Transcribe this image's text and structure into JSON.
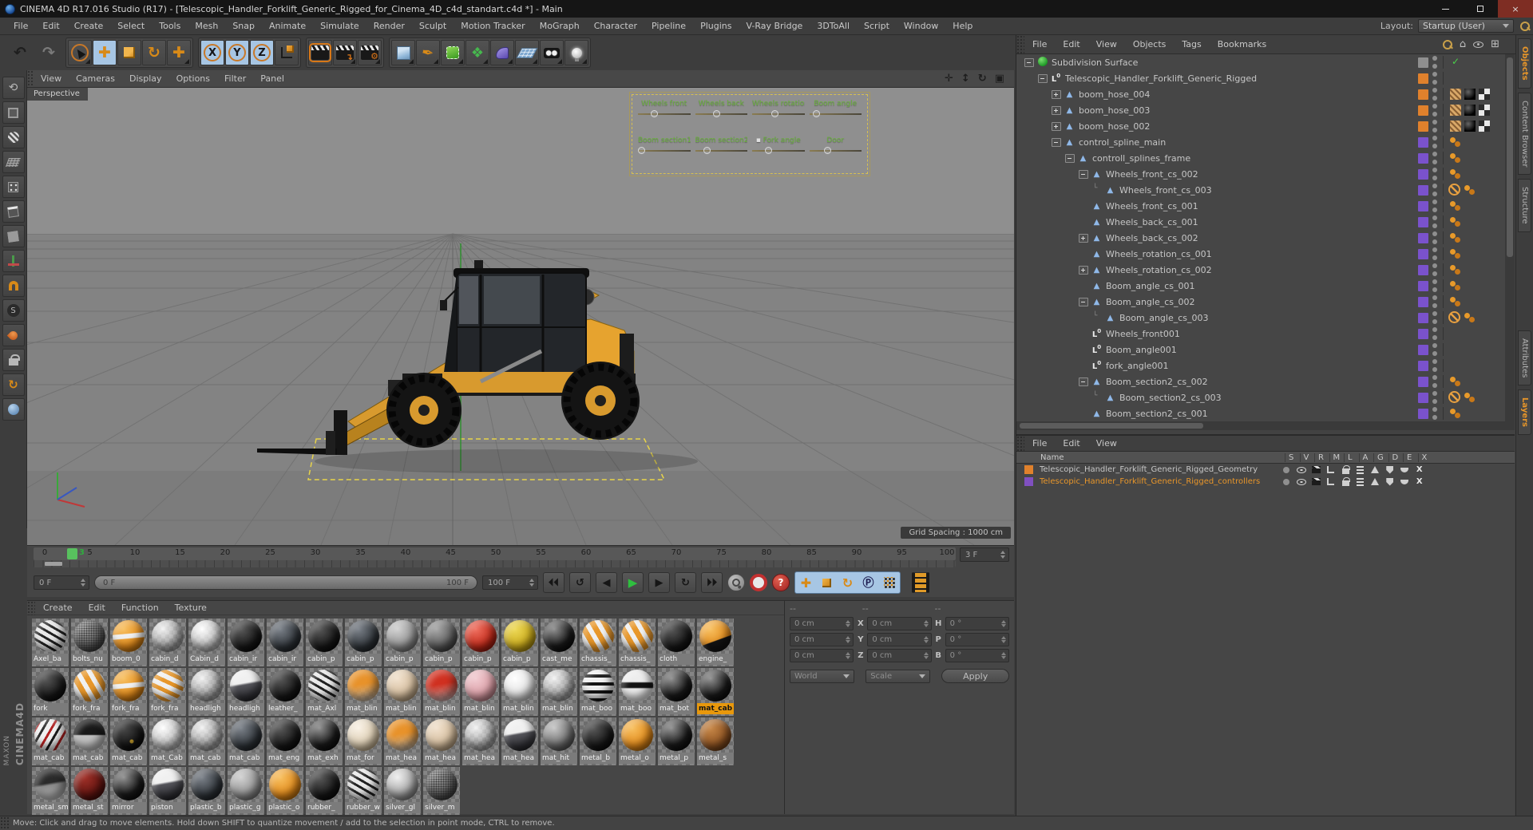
{
  "window": {
    "title": "CINEMA 4D R17.016 Studio (R17) - [Telescopic_Handler_Forklift_Generic_Rigged_for_Cinema_4D_c4d_standart.c4d *] - Main"
  },
  "menu": [
    "File",
    "Edit",
    "Create",
    "Select",
    "Tools",
    "Mesh",
    "Snap",
    "Animate",
    "Simulate",
    "Render",
    "Sculpt",
    "Motion Tracker",
    "MoGraph",
    "Character",
    "Pipeline",
    "Plugins",
    "V-Ray Bridge",
    "3DToAll",
    "Script",
    "Window",
    "Help"
  ],
  "layout_switcher": {
    "label": "Layout:",
    "value": "Startup (User)"
  },
  "toolbar_icons": [
    "undo",
    "redo",
    "live-selection",
    "move",
    "scale",
    "rotate",
    "move-active",
    "lock-x",
    "lock-y",
    "lock-z",
    "coordinate-system",
    "render-view",
    "render-to-picture-viewer",
    "edit-render-settings",
    "add-cube-object",
    "freehand-spline",
    "subdivision-surface",
    "mograph",
    "deformer",
    "floor-object",
    "camera-object",
    "light-object"
  ],
  "palette_icons": [
    "make-editable",
    "model-mode",
    "texture-mode",
    "workplane-mode",
    "points-mode",
    "edges-mode",
    "polygons-mode",
    "enable-axis",
    "snap-magnet",
    "viewport-solo",
    "paint-drop",
    "lock-workplane",
    "rotate-workplane",
    "sphere-mode"
  ],
  "viewport": {
    "menu": [
      "View",
      "Cameras",
      "Display",
      "Options",
      "Filter",
      "Panel"
    ],
    "label": "Perspective",
    "grid_spacing": "Grid Spacing : 1000 cm",
    "hud": {
      "row1": [
        {
          "label": "Wheels front",
          "pos": 0.3
        },
        {
          "label": "Wheels back",
          "pos": 0.42
        },
        {
          "label": "Wheels rotation",
          "pos": 0.45
        },
        {
          "label": "Boom angle",
          "pos": 0.08
        }
      ],
      "row2": [
        {
          "label": "Boom section1",
          "pos": 0.0
        },
        {
          "label": "Boom section2",
          "pos": 0.2
        },
        {
          "label": "Fork angle",
          "pos": 0.3,
          "mark": "mark"
        },
        {
          "label": "Door",
          "pos": 0.36
        }
      ]
    }
  },
  "timeline": {
    "ticks": [
      {
        "label": "0",
        "f": 0
      },
      {
        "label": "5",
        "f": 5
      },
      {
        "label": "10",
        "f": 10
      },
      {
        "label": "15",
        "f": 15
      },
      {
        "label": "20",
        "f": 20
      },
      {
        "label": "25",
        "f": 25
      },
      {
        "label": "30",
        "f": 30
      },
      {
        "label": "35",
        "f": 35
      },
      {
        "label": "40",
        "f": 40
      },
      {
        "label": "45",
        "f": 45
      },
      {
        "label": "50",
        "f": 50
      },
      {
        "label": "55",
        "f": 55
      },
      {
        "label": "60",
        "f": 60
      },
      {
        "label": "65",
        "f": 65
      },
      {
        "label": "70",
        "f": 70
      },
      {
        "label": "75",
        "f": 75
      },
      {
        "label": "80",
        "f": 80
      },
      {
        "label": "85",
        "f": 85
      },
      {
        "label": "90",
        "f": 90
      },
      {
        "label": "95",
        "f": 95
      },
      {
        "label": "100",
        "f": 100
      }
    ],
    "playhead_label": "3",
    "current_frame_field": "3 F",
    "start_field": "0 F",
    "end_field": "100 F",
    "range_start": "0 F",
    "range_end": "100 F"
  },
  "materials": {
    "menu": [
      "Create",
      "Edit",
      "Function",
      "Texture"
    ],
    "items": [
      {
        "name": "Axel_ba",
        "tone": "t-pbw"
      },
      {
        "name": "bolts_nu",
        "tone": "t-speck"
      },
      {
        "name": "boom_0",
        "tone": "t-ow"
      },
      {
        "name": "cabin_d",
        "tone": "t-clear"
      },
      {
        "name": "Cabin_d",
        "tone": "t-clearw"
      },
      {
        "name": "cabin_ir",
        "tone": "t-black"
      },
      {
        "name": "cabin_ir",
        "tone": "t-dgray"
      },
      {
        "name": "cabin_p",
        "tone": "t-black"
      },
      {
        "name": "cabin_p",
        "tone": "t-dgray"
      },
      {
        "name": "cabin_p",
        "tone": "t-lgray"
      },
      {
        "name": "cabin_p",
        "tone": "t-gray"
      },
      {
        "name": "cabin_p",
        "tone": "t-red"
      },
      {
        "name": "cabin_p",
        "tone": "t-yellow"
      },
      {
        "name": "cast_me",
        "tone": "t-blacksh"
      },
      {
        "name": "chassis_",
        "tone": "t-powy"
      },
      {
        "name": "chassis_",
        "tone": "t-powy"
      },
      {
        "name": "cloth",
        "tone": "t-black"
      },
      {
        "name": "engine_",
        "tone": "t-orangeb"
      },
      {
        "name": "fork",
        "tone": "t-black"
      },
      {
        "name": "fork_fra",
        "tone": "t-powy"
      },
      {
        "name": "fork_fra",
        "tone": "t-ow"
      },
      {
        "name": "fork_fra",
        "tone": "t-pwo"
      },
      {
        "name": "headligh",
        "tone": "t-clear"
      },
      {
        "name": "headligh",
        "tone": "t-chrome"
      },
      {
        "name": "leather_",
        "tone": "t-black"
      },
      {
        "name": "mat_Axl",
        "tone": "t-pbw"
      },
      {
        "name": "mat_blin",
        "tone": "t-oclear"
      },
      {
        "name": "mat_blin",
        "tone": "t-tanc"
      },
      {
        "name": "mat_blin",
        "tone": "t-redc"
      },
      {
        "name": "mat_blin",
        "tone": "t-pink"
      },
      {
        "name": "mat_blin",
        "tone": "t-frost"
      },
      {
        "name": "mat_blin",
        "tone": "t-clear"
      },
      {
        "name": "mat_boo",
        "tone": "t-stripe"
      },
      {
        "name": "mat_boo",
        "tone": "t-stripe2"
      },
      {
        "name": "mat_bot",
        "tone": "t-blacksh"
      },
      {
        "name": "mat_cab",
        "tone": "t-blacksh",
        "sel": "sel"
      },
      {
        "name": "mat_cab",
        "tone": "t-pbw2"
      },
      {
        "name": "mat_cab",
        "tone": "t-halfbw"
      },
      {
        "name": "mat_cab",
        "tone": "t-blackg"
      },
      {
        "name": "mat_Cab",
        "tone": "t-clearw"
      },
      {
        "name": "mat_cab",
        "tone": "t-clear"
      },
      {
        "name": "mat_cab",
        "tone": "t-dgray"
      },
      {
        "name": "mat_eng",
        "tone": "t-black"
      },
      {
        "name": "mat_exh",
        "tone": "t-blacksh"
      },
      {
        "name": "mat_for",
        "tone": "t-tanw"
      },
      {
        "name": "mat_hea",
        "tone": "t-oclear"
      },
      {
        "name": "mat_hea",
        "tone": "t-tanc"
      },
      {
        "name": "mat_hea",
        "tone": "t-clear"
      },
      {
        "name": "mat_hea",
        "tone": "t-chrome"
      },
      {
        "name": "mat_hit",
        "tone": "t-metal"
      },
      {
        "name": "metal_b",
        "tone": "t-black"
      },
      {
        "name": "metal_o",
        "tone": "t-orange"
      },
      {
        "name": "metal_p",
        "tone": "t-blacksh"
      },
      {
        "name": "metal_s",
        "tone": "t-brown"
      },
      {
        "name": "metal_sm",
        "tone": "t-chromeb"
      },
      {
        "name": "metal_st",
        "tone": "t-dred"
      },
      {
        "name": "mirror",
        "tone": "t-blacksh"
      },
      {
        "name": "piston",
        "tone": "t-chrome"
      },
      {
        "name": "plastic_b",
        "tone": "t-dgray"
      },
      {
        "name": "plastic_g",
        "tone": "t-lgray"
      },
      {
        "name": "plastic_o",
        "tone": "t-orange"
      },
      {
        "name": "rubber_",
        "tone": "t-black"
      },
      {
        "name": "rubber_w",
        "tone": "t-pbw"
      },
      {
        "name": "silver_gl",
        "tone": "t-silver"
      },
      {
        "name": "silver_m",
        "tone": "t-speck"
      }
    ]
  },
  "coords": {
    "headers": [
      "--",
      "--",
      "--"
    ],
    "rows": [
      {
        "pos": "0 cm",
        "axis2": "X",
        "size": "0 cm",
        "axis3": "H",
        "rot": "0 °"
      },
      {
        "pos": "0 cm",
        "axis2": "Y",
        "size": "0 cm",
        "axis3": "P",
        "rot": "0 °"
      },
      {
        "pos": "0 cm",
        "axis2": "Z",
        "size": "0 cm",
        "axis3": "B",
        "rot": "0 °"
      }
    ],
    "space": "World",
    "mode": "Scale",
    "apply": "Apply"
  },
  "object_manager": {
    "menu": [
      "File",
      "Edit",
      "View",
      "Objects",
      "Tags",
      "Bookmarks"
    ],
    "tree": [
      {
        "name": "Subdivision Surface",
        "lvl": 0,
        "exp": "minus",
        "icon": "sds",
        "chip": "#8f8f8f",
        "tags": "check"
      },
      {
        "name": "Telescopic_Handler_Forklift_Generic_Rigged",
        "lvl": 1,
        "exp": "minus",
        "icon": "null",
        "chip": "#e0812c",
        "tags": "none"
      },
      {
        "name": "boom_hose_004",
        "lvl": 2,
        "exp": "plus",
        "icon": "joint",
        "chip": "#e0812c",
        "tags": "boom"
      },
      {
        "name": "boom_hose_003",
        "lvl": 2,
        "exp": "plus",
        "icon": "joint",
        "chip": "#e0812c",
        "tags": "boom"
      },
      {
        "name": "boom_hose_002",
        "lvl": 2,
        "exp": "plus",
        "icon": "joint",
        "chip": "#e0812c",
        "tags": "boom"
      },
      {
        "name": "control_spline_main",
        "lvl": 2,
        "exp": "minus",
        "icon": "joint",
        "chip": "#7a52cc",
        "tags": "dots"
      },
      {
        "name": "controll_splines_frame",
        "lvl": 3,
        "exp": "minus",
        "icon": "joint",
        "chip": "#7a52cc",
        "tags": "dots"
      },
      {
        "name": "Wheels_front_cs_002",
        "lvl": 4,
        "exp": "minus",
        "icon": "joint",
        "chip": "#7a52cc",
        "tags": "dots"
      },
      {
        "name": "Wheels_front_cs_003",
        "lvl": 5,
        "exp": "end",
        "icon": "joint",
        "chip": "#7a52cc",
        "tags": "nodots"
      },
      {
        "name": "Wheels_front_cs_001",
        "lvl": 4,
        "exp": "none",
        "icon": "joint",
        "chip": "#7a52cc",
        "tags": "dots"
      },
      {
        "name": "Wheels_back_cs_001",
        "lvl": 4,
        "exp": "none",
        "icon": "joint",
        "chip": "#7a52cc",
        "tags": "dots"
      },
      {
        "name": "Wheels_back_cs_002",
        "lvl": 4,
        "exp": "plus",
        "icon": "joint",
        "chip": "#7a52cc",
        "tags": "dots"
      },
      {
        "name": "Wheels_rotation_cs_001",
        "lvl": 4,
        "exp": "none",
        "icon": "joint",
        "chip": "#7a52cc",
        "tags": "dots"
      },
      {
        "name": "Wheels_rotation_cs_002",
        "lvl": 4,
        "exp": "plus",
        "icon": "joint",
        "chip": "#7a52cc",
        "tags": "dots"
      },
      {
        "name": "Boom_angle_cs_001",
        "lvl": 4,
        "exp": "none",
        "icon": "joint",
        "chip": "#7a52cc",
        "tags": "dots"
      },
      {
        "name": "Boom_angle_cs_002",
        "lvl": 4,
        "exp": "minus",
        "icon": "joint",
        "chip": "#7a52cc",
        "tags": "dots"
      },
      {
        "name": "Boom_angle_cs_003",
        "lvl": 5,
        "exp": "end",
        "icon": "joint",
        "chip": "#7a52cc",
        "tags": "nodots"
      },
      {
        "name": "Wheels_front001",
        "lvl": 4,
        "exp": "none",
        "icon": "null",
        "chip": "#7a52cc",
        "tags": "none"
      },
      {
        "name": "Boom_angle001",
        "lvl": 4,
        "exp": "none",
        "icon": "null",
        "chip": "#7a52cc",
        "tags": "none"
      },
      {
        "name": "fork_angle001",
        "lvl": 4,
        "exp": "none",
        "icon": "null",
        "chip": "#7a52cc",
        "tags": "none"
      },
      {
        "name": "Boom_section2_cs_002",
        "lvl": 4,
        "exp": "minus",
        "icon": "joint",
        "chip": "#7a52cc",
        "tags": "dots"
      },
      {
        "name": "Boom_section2_cs_003",
        "lvl": 5,
        "exp": "end",
        "icon": "joint",
        "chip": "#7a52cc",
        "tags": "nodots"
      },
      {
        "name": "Boom_section2_cs_001",
        "lvl": 4,
        "exp": "none",
        "icon": "joint",
        "chip": "#7a52cc",
        "tags": "dots"
      }
    ]
  },
  "layer_manager": {
    "menu": [
      "File",
      "Edit",
      "View"
    ],
    "name_header": "Name",
    "columns": [
      "S",
      "V",
      "R",
      "M",
      "L",
      "A",
      "G",
      "D",
      "E",
      "X"
    ],
    "rows": [
      {
        "name": "Telescopic_Handler_Forklift_Generic_Rigged_Geometry",
        "chip": "#e0812c",
        "cls": ""
      },
      {
        "name": "Telescopic_Handler_Forklift_Generic_Rigged_controllers",
        "chip": "#8050c0",
        "cls": "hl"
      }
    ]
  },
  "side_tabs": {
    "top": [
      {
        "label": "Objects",
        "cls": "active"
      },
      {
        "label": "Content Browser",
        "cls": ""
      },
      {
        "label": "Structure",
        "cls": ""
      }
    ],
    "bottom": [
      {
        "label": "Attributes",
        "cls": "gap"
      },
      {
        "label": "Layers",
        "cls": "active"
      }
    ]
  },
  "status": "Move: Click and drag to move elements. Hold down SHIFT to quantize movement / add to the selection in point mode, CTRL to remove.",
  "branding": {
    "vendor": "MAXON",
    "app": "CINEMA4D"
  }
}
